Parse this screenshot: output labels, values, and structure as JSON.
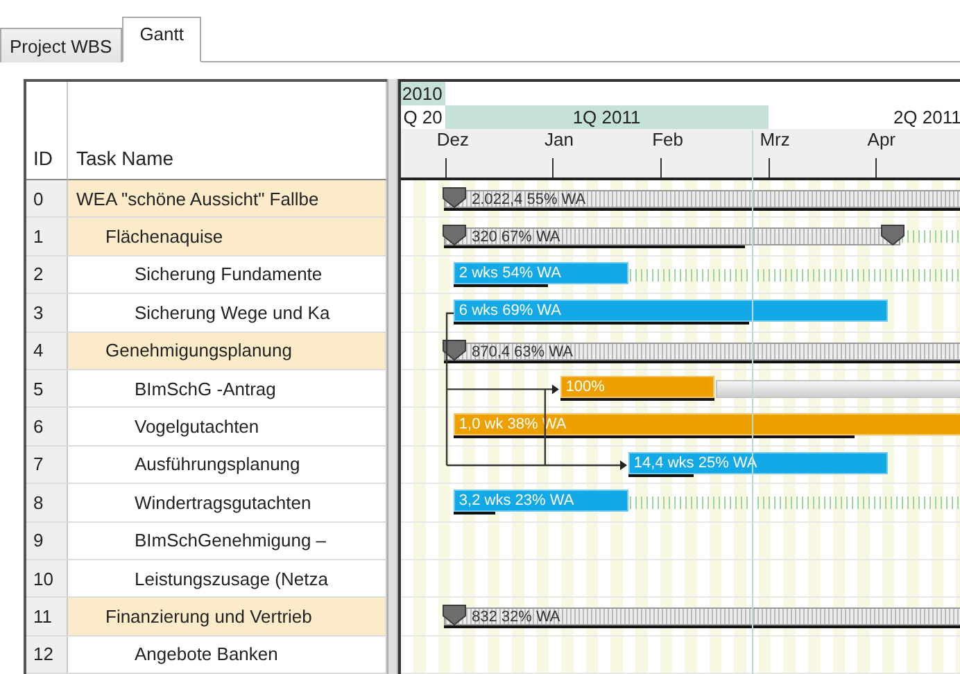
{
  "tabs": [
    {
      "label": "Project WBS",
      "selected": false
    },
    {
      "label": "Gantt",
      "selected": true
    }
  ],
  "table": {
    "columns": [
      "ID",
      "Task Name"
    ],
    "tasks": [
      {
        "id": "0",
        "name": "WEA \"schöne Aussicht\" Fallbe",
        "bar": {
          "kind": "summary",
          "label": "2.022,4 55% WA",
          "start": {
            "level": 0.076
          },
          "finish": {
            "level": 1
          },
          "level": 1
        },
        "children": [
          {
            "id": "1",
            "name": "Flächenaquise",
            "bar": {
              "kind": "summary",
              "label": "320 67% WA",
              "start": {
                "level": 0.076
              },
              "finish": {
                "level": 0.88
              },
              "level": 0.66,
              "extension": {
                "kind": "slack"
              }
            },
            "children": [
              {
                "id": "2",
                "name": "Sicherung Fundamente",
                "bar": {
                  "kind": "task",
                  "color": "#13a9e6",
                  "label": "2 wks 54% WA",
                  "start": {
                    "level": 0.093
                  },
                  "finish": {
                    "level": 0.401
                  },
                  "level": 0.54,
                  "extension": {
                    "kind": "slack"
                  }
                }
              },
              {
                "id": "3",
                "name": "Sicherung Wege und Ka",
                "bar": {
                  "kind": "task",
                  "color": "#13a9e6",
                  "label": "6 wks 69% WA",
                  "start": {
                    "level": 0.093
                  },
                  "finish": {
                    "level": 0.858
                  },
                  "level": 0.68
                }
              }
            ]
          },
          {
            "id": "4",
            "name": "Genehmigungsplanung",
            "bar": {
              "kind": "summary",
              "label": "870,4 63% WA",
              "start": {
                "level": 0.076
              },
              "finish": {
                "level": 1
              },
              "level": 1
            },
            "children": [
              {
                "id": "5",
                "name": "BImSchG -Antrag",
                "bar": {
                  "kind": "task",
                  "color": "#eea000",
                  "label": "100%",
                  "start": {
                    "level": 0.281
                  },
                  "finish": {
                    "level": 0.553
                  },
                  "level": 1,
                  "arrow_in": true,
                  "extension": {
                    "kind": "baseline"
                  }
                }
              },
              {
                "id": "6",
                "name": "Vogelgutachten",
                "bar": {
                  "kind": "task",
                  "color": "#eea000",
                  "label": "1,0 wk 38% WA",
                  "start": {
                    "level": 0.093
                  },
                  "finish": {
                    "level": 1
                  },
                  "level": 0.78
                }
              },
              {
                "id": "7",
                "name": "Ausführungsplanung",
                "bar": {
                  "kind": "task",
                  "color": "#13a9e6",
                  "label": "14,4 wks 25% WA",
                  "start": {
                    "level": 0.401
                  },
                  "finish": {
                    "level": 0.858
                  },
                  "level": 0.25,
                  "arrow_in": true
                }
              },
              {
                "id": "8",
                "name": "Windertragsgutachten",
                "bar": {
                  "kind": "task",
                  "color": "#13a9e6",
                  "label": "3,2 wks 23% WA",
                  "start": {
                    "level": 0.093
                  },
                  "finish": {
                    "level": 0.401
                  },
                  "level": 0.24,
                  "extension": {
                    "kind": "slack"
                  }
                }
              },
              {
                "id": "9",
                "name": "BImSchGenehmigung –"
              },
              {
                "id": "10",
                "name": "Leistungszusage (Netza"
              }
            ]
          },
          {
            "id": "11",
            "name": "Finanzierung und Vertrieb",
            "bar": {
              "kind": "summary",
              "label": "832 32% WA",
              "start": {
                "level": 0.076
              },
              "finish": {
                "level": 1
              },
              "level": 1
            },
            "children": [
              {
                "id": "12",
                "name": "Angebote Banken"
              }
            ]
          }
        ]
      }
    ]
  },
  "gantt": {
    "years": [
      {
        "label": "2010",
        "highlighted": true
      }
    ],
    "quarters": [
      {
        "label": "Q 20",
        "highlighted": false
      },
      {
        "label": "1Q 2011",
        "highlighted": true
      },
      {
        "label": "2Q 2011",
        "highlighted": false
      }
    ],
    "months": [
      {
        "label": "Dez"
      },
      {
        "label": "Jan"
      },
      {
        "label": "Feb"
      },
      {
        "label": "Mrz"
      },
      {
        "label": "Apr"
      }
    ],
    "today": {
      "level": 0.619
    }
  }
}
